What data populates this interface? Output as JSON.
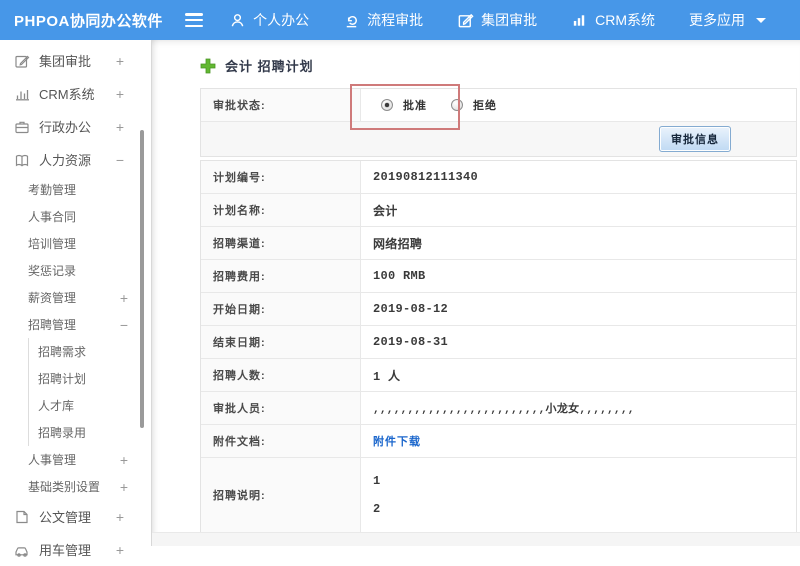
{
  "topbar": {
    "app_title": "PHPOA协同办公软件",
    "nav": [
      {
        "icon": "user-icon",
        "label": "个人办公"
      },
      {
        "icon": "flow-approval-icon",
        "label": "流程审批"
      },
      {
        "icon": "edit-square-icon",
        "label": "集团审批"
      },
      {
        "icon": "bar-chart-icon",
        "label": "CRM系统"
      },
      {
        "icon": "caret-down-icon",
        "label": "更多应用"
      }
    ]
  },
  "sidebar": {
    "items": [
      {
        "icon": "edit-square-icon",
        "label": "集团审批",
        "toggle": "+"
      },
      {
        "icon": "bar-chart-icon",
        "label": "CRM系统",
        "toggle": "+"
      },
      {
        "icon": "briefcase-icon",
        "label": "行政办公",
        "toggle": "+"
      },
      {
        "icon": "book-icon",
        "label": "人力资源",
        "toggle": "−"
      },
      {
        "label": "考勤管理"
      },
      {
        "label": "人事合同"
      },
      {
        "label": "培训管理"
      },
      {
        "label": "奖惩记录"
      },
      {
        "label": "薪资管理",
        "toggle": "+"
      },
      {
        "label": "招聘管理",
        "toggle": "−"
      },
      {
        "label": "招聘需求"
      },
      {
        "label": "招聘计划"
      },
      {
        "label": "人才库"
      },
      {
        "label": "招聘录用"
      },
      {
        "label": "人事管理",
        "toggle": "+"
      },
      {
        "label": "基础类别设置",
        "toggle": "+"
      },
      {
        "icon": "document-icon",
        "label": "公文管理",
        "toggle": "+"
      },
      {
        "icon": "car-icon",
        "label": "用车管理",
        "toggle": "+"
      }
    ]
  },
  "main": {
    "page_title": "会计 招聘计划",
    "approval": {
      "status_label": "审批状态:",
      "options": [
        {
          "label": "批准",
          "selected": true
        },
        {
          "label": "拒绝",
          "selected": false
        }
      ],
      "info_button": "审批信息"
    },
    "form": {
      "rows": [
        {
          "label": "计划编号:",
          "value": "20190812111340"
        },
        {
          "label": "计划名称:",
          "value": "会计"
        },
        {
          "label": "招聘渠道:",
          "value": "网络招聘"
        },
        {
          "label": "招聘费用:",
          "value": "100 RMB"
        },
        {
          "label": "开始日期:",
          "value": "2019-08-12"
        },
        {
          "label": "结束日期:",
          "value": "2019-08-31"
        },
        {
          "label": "招聘人数:",
          "value": "1 人"
        },
        {
          "label": "审批人员:",
          "value": ",,,,,,,,,,,,,,,,,,,,,,,,,小龙女,,,,,,,,"
        },
        {
          "label": "附件文档:",
          "value": "附件下载"
        },
        {
          "label": "招聘说明:",
          "lines": [
            "1",
            "2"
          ]
        }
      ]
    }
  },
  "colors": {
    "header_blue": "#4797e8",
    "annotation_red": "#cf7a7a",
    "link_blue": "#1a66cc",
    "plus_green": "#62b831"
  }
}
